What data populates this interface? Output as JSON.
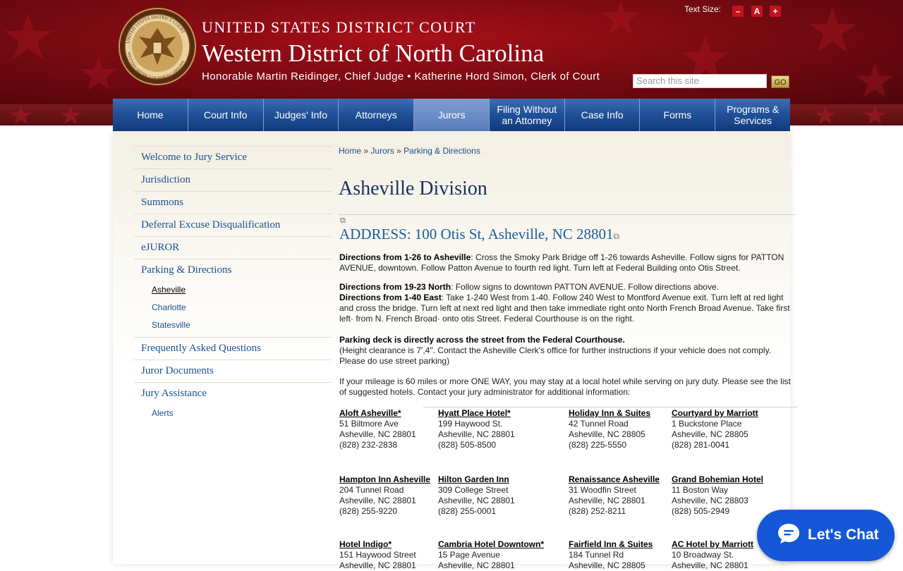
{
  "header": {
    "line1": "UNITED STATES DISTRICT COURT",
    "line2": "Western District of North Carolina",
    "line3": "Honorable Martin Reidinger, Chief Judge • Katherine Hord Simon, Clerk of Court",
    "seal_top_text": "UNITED STATES DISTRICT COURT",
    "seal_bottom_text": "WESTERN DISTRICT OF NORTH CAROLINA",
    "text_size_label": "Text Size:",
    "ts_minus": "–",
    "ts_reset": "A",
    "ts_plus": "+",
    "search_placeholder": "Search this site",
    "go_label": "GO"
  },
  "nav": {
    "items": [
      "Home",
      "Court Info",
      "Judges' Info",
      "Attorneys",
      "Jurors",
      "Filing Without an Attorney",
      "Case Info",
      "Forms",
      "Programs & Services"
    ],
    "active": "Jurors"
  },
  "sidebar": {
    "items": [
      {
        "label": "Welcome to Jury Service"
      },
      {
        "label": "Jurisdiction"
      },
      {
        "label": "Summons"
      },
      {
        "label": "Deferral Excuse Disqualification"
      },
      {
        "label": "eJUROR"
      },
      {
        "label": "Parking & Directions"
      },
      {
        "label": "Frequently Asked Questions"
      },
      {
        "label": "Juror Documents"
      },
      {
        "label": "Jury Assistance"
      }
    ],
    "parking_subs": [
      "Asheville",
      "Charlotte",
      "Statesville"
    ],
    "assistance_subs": [
      "Alerts"
    ]
  },
  "breadcrumb": {
    "home": "Home",
    "jurors": "Jurors",
    "parking": "Parking & Directions",
    "sep": "»"
  },
  "main": {
    "title": "Asheville Division",
    "address": "ADDRESS:  100 Otis St, Asheville, NC 28801",
    "dir1_label": "Directions from 1-26 to Asheville",
    "dir1_text": ": Cross the Smoky Park Bridge off 1-26 towards Asheville. Follow signs for PATTON AVENUE, downtown. Follow Patton Avenue to fourth red light. Turn left at Federal Building onto Otis Street.",
    "dir2_label": "Directions from 19-23 North",
    "dir2_text": ": Follow signs to downtown PATTON AVENUE. Follow directions above.",
    "dir3_label": "Directions from 1-40 East",
    "dir3_text": ": Take 1-240 West from 1-40. Follow 240 West to Montford Avenue exit. Turn left at red light and cross the bridge. Turn left at next red light and then take immediate right onto North French Broad Avenue. Take first left· from N. French Broad· onto otis Street. Federal Courthouse is on the right.",
    "parking_label": "Parking deck is directly across the street from the Federal Courthouse.",
    "parking_text": "(Height clearance is 7',4\".  Contact the Asheville Clerk's office for further instructions if your vehicle does not comply. Please do use street parking)",
    "mileage_text": "If your mileage is 60 miles or more ONE WAY, you may stay at a local hotel while serving on jury duty. Please see the list of suggested hotels. Contact your jury administrator for additional information:"
  },
  "hotels": [
    {
      "name": "Aloft Asheville*",
      "street": "51 Biltmore Ave",
      "city": "Asheville, NC 28801",
      "phone": "(828) 232-2838"
    },
    {
      "name": "Hyatt Place Hotel*",
      "street": "199 Haywood St.",
      "city": "Asheville, NC 28801",
      "phone": "(828} 505-8500"
    },
    {
      "name": "Holiday Inn & Suites",
      "street": "42 Tunnel Road",
      "city": "Asheville, NC 28805",
      "phone": "(828} 225-5550"
    },
    {
      "name": "Courtyard by Marriott",
      "street": "1 Buckstone Place",
      "city": "Asheville, NC 28805",
      "phone": " (828) 281-0041"
    },
    {
      "name": "Hampton Inn Asheville",
      "street": "204 Tunnel Road",
      "city": "Asheville, NC 28801",
      "phone": "(828) 255-9220"
    },
    {
      "name": "Hilton Garden Inn",
      "street": "309 College Street",
      "city": "Asheville, NC 28801",
      "phone": "(828} 255-0001"
    },
    {
      "name": "Renaissance Asheville",
      "street": "31 Woodfin Street",
      "city": "Asheville, NC 28801",
      "phone": "(828) 252-8211"
    },
    {
      "name": "Grand Bohemian Hotel",
      "street": "11 Boston Way",
      "city": "Asheville, NC 28803",
      "phone": "(828) 505-2949"
    },
    {
      "name": "Hotel Indigo*",
      "street": "151 Haywood Street",
      "city": "Asheville, NC 28801",
      "phone": ""
    },
    {
      "name": "Cambria Hotel Downtown*",
      "street": "15 Page Avenue",
      "city": "Asheville, NC 28801",
      "phone": ""
    },
    {
      "name": "Fairfield Inn & Suites",
      "street": "184 Tunnel Rd",
      "city": "Asheville, NC 28805",
      "phone": ""
    },
    {
      "name": "AC Hotel by Marriott",
      "street": "10 Broadway St.",
      "city": "Asheville, NC 28801",
      "phone": ""
    }
  ],
  "chat": {
    "label": "Let's Chat"
  },
  "colors": {
    "header_red": "#8a0c14",
    "nav_blue": "#1f4f97",
    "link_blue": "#1c4f8f",
    "chat_blue": "#1557d6"
  }
}
